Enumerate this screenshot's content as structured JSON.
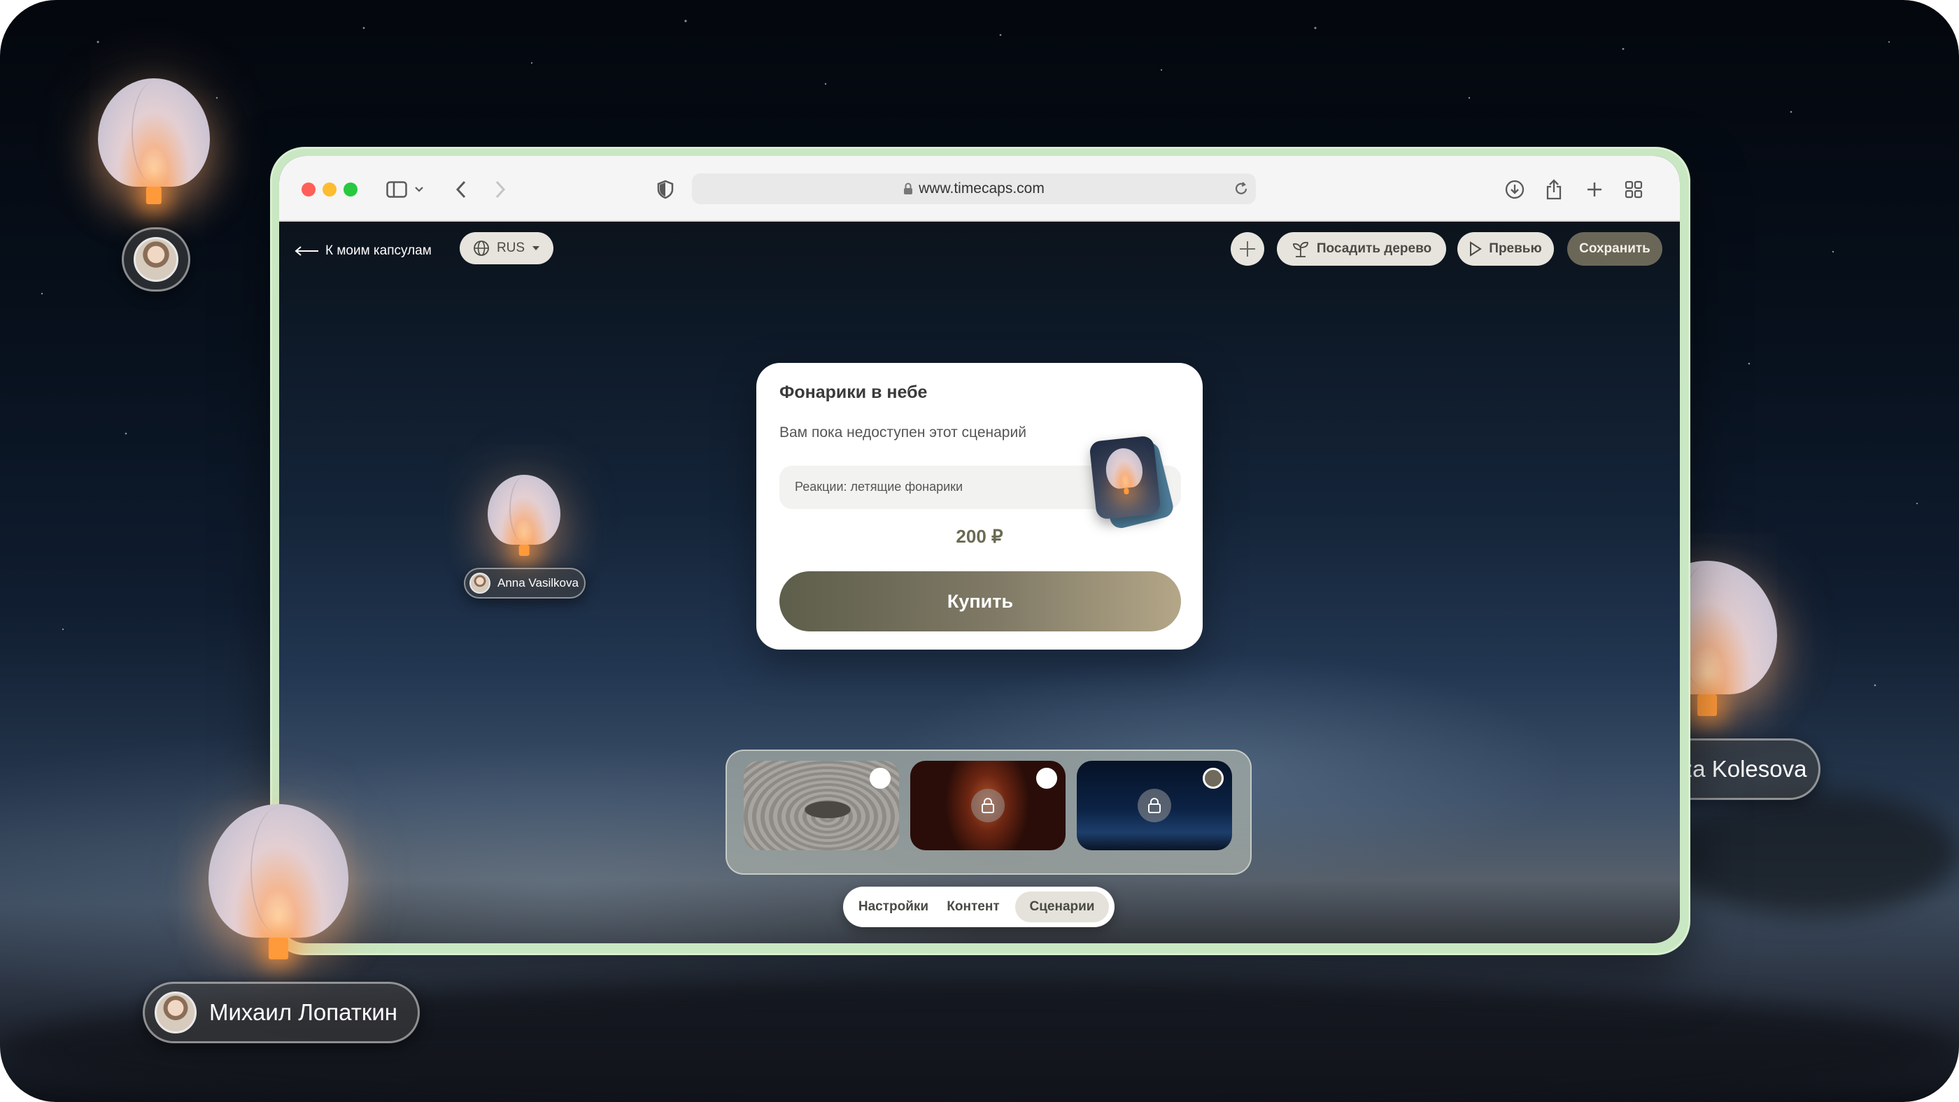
{
  "browser": {
    "url": "www.timecaps.com"
  },
  "app_bar": {
    "back_label": "К моим капсулам",
    "language": "RUS",
    "plant_tree_label": "Посадить дерево",
    "preview_label": "Превью",
    "save_label": "Сохранить"
  },
  "card": {
    "title": "Фонарики в небе",
    "subtitle": "Вам пока недоступен этот сценарий",
    "reaction": "Реакции: летящие фонарики",
    "price": "200 ₽",
    "buy_label": "Купить"
  },
  "scenarios": [
    {
      "name": "zen-stone",
      "locked": false,
      "selected": true
    },
    {
      "name": "candle-hall",
      "locked": true,
      "selected": true
    },
    {
      "name": "night-sky",
      "locked": true,
      "selected": false
    }
  ],
  "tabs": [
    {
      "label": "Настройки",
      "active": false
    },
    {
      "label": "Контент",
      "active": false
    },
    {
      "label": "Сценарии",
      "active": true
    }
  ],
  "users": {
    "inner": "Anna Vasilkova",
    "right": "Liza Kolesova",
    "bottom_left": "Михаил Лопаткин"
  },
  "colors": {
    "accent_dark": "#6b6758",
    "browser_border": "#c9e7c2",
    "price": "#6b6b55"
  }
}
